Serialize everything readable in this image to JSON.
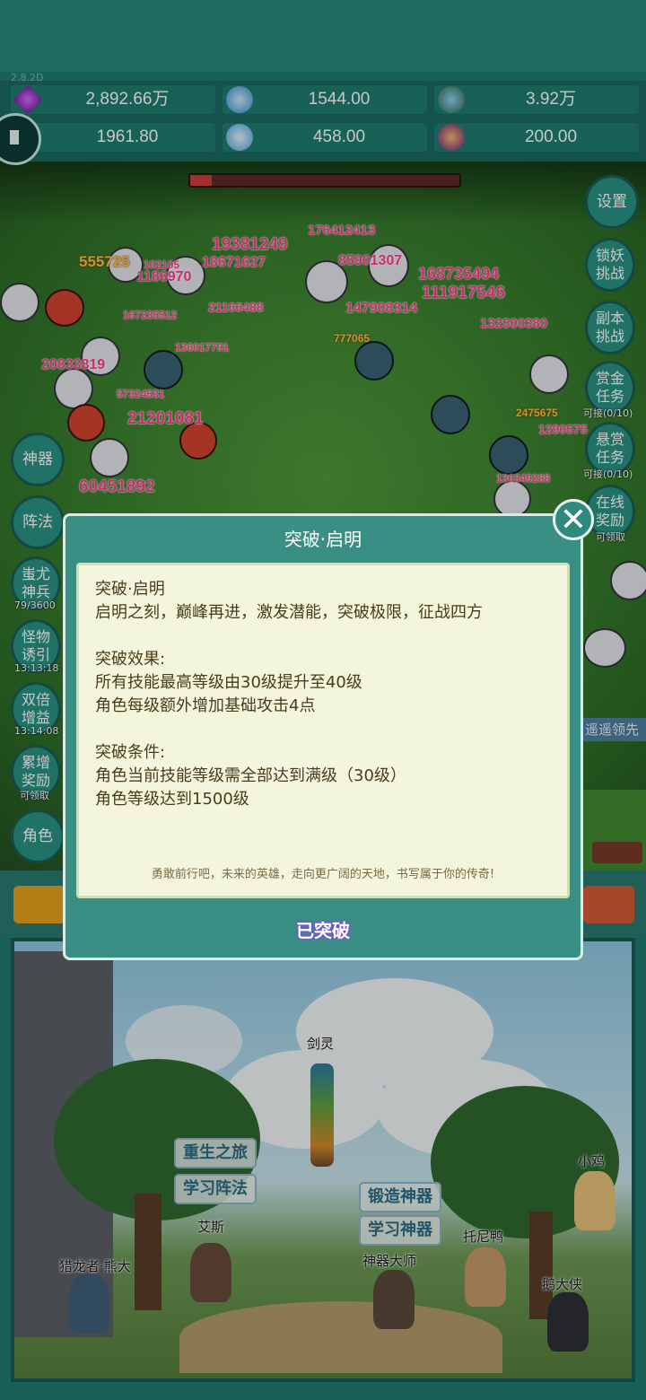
{
  "version": "2.8.2D",
  "resources": [
    {
      "icon": "purple-gem-icon",
      "value": "2,892.66万"
    },
    {
      "icon": "blue-crystal-icon",
      "value": "1544.00"
    },
    {
      "icon": "globe-orb-icon",
      "value": "3.92万"
    },
    {
      "icon": "horn-icon",
      "value": "1961.80"
    },
    {
      "icon": "ice-shard-icon",
      "value": "458.00"
    },
    {
      "icon": "potion-icon",
      "value": "200.00"
    }
  ],
  "battle": {
    "damage_numbers": [
      "555725",
      "19381249",
      "176412413",
      "18671627",
      "1186970",
      "102105",
      "85901307",
      "168735494",
      "111917546",
      "21166488",
      "167235512",
      "147908314",
      "132500380",
      "20833819",
      "57324531",
      "21201081",
      "60451892",
      "2475675",
      "1290575",
      "130349288",
      "777065",
      "136017791"
    ],
    "boss_hp_fraction": 0.08
  },
  "right_buttons": [
    {
      "label": "设置",
      "sub": ""
    },
    {
      "label": "锁妖挑战",
      "sub": ""
    },
    {
      "label": "副本挑战",
      "sub": ""
    },
    {
      "label": "赏金任务",
      "sub": "可接(0/10)"
    },
    {
      "label": "悬赏任务",
      "sub": "可接(0/10)"
    },
    {
      "label": "在线奖励",
      "sub": "可领取"
    }
  ],
  "left_buttons": [
    {
      "label": "神器",
      "sub": ""
    },
    {
      "label": "阵法",
      "sub": ""
    },
    {
      "label": "蚩尤神兵",
      "sub": "79/3600"
    },
    {
      "label": "怪物诱引",
      "sub": "13:13:18"
    },
    {
      "label": "双倍增益",
      "sub": "13:14:08"
    },
    {
      "label": "累增奖励",
      "sub": "可领取"
    },
    {
      "label": "角色",
      "sub": ""
    }
  ],
  "leader_text": "遥遥领先",
  "modal": {
    "title": "突破·启明",
    "heading": "突破·启明",
    "intro": "启明之刻，巅峰再进，激发潜能，突破极限，征战四方",
    "effect_title": "突破效果:",
    "effects": [
      "所有技能最高等级由30级提升至40级",
      "角色每级额外增加基础攻击4点"
    ],
    "condition_title": "突破条件:",
    "conditions": [
      "角色当前技能等级需全部达到满级（30级）",
      "角色等级达到1500级"
    ],
    "motto": "勇敢前行吧，未来的英雄，走向更广阔的天地，书写属于你的传奇!",
    "status": "已突破",
    "close_icon": "close-icon"
  },
  "scene": {
    "buttons": {
      "rebirth": "重生之旅",
      "learn_formation": "学习阵法",
      "forge_artifact": "锻造神器",
      "learn_artifact": "学习神器"
    },
    "npcs": {
      "sword_spirit": "剑灵",
      "chick": "小鸡",
      "ace": "艾斯",
      "tony_duck": "托尼鸭",
      "dragon_hunter": "猎龙者·熊大",
      "artifact_master": "神器大师",
      "goose_hero": "鹅大侠"
    }
  }
}
